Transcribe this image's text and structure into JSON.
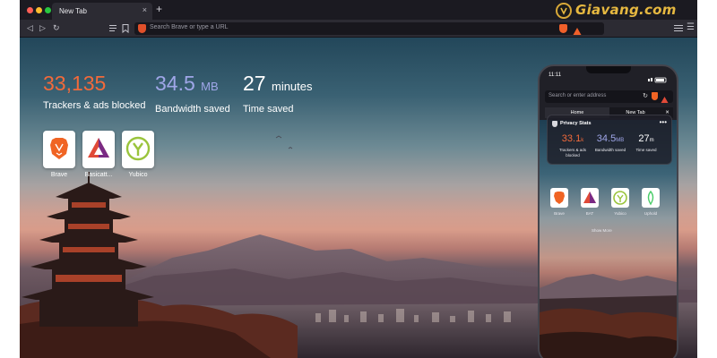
{
  "window": {
    "traffic_lights": [
      "#ff5f57",
      "#febc2e",
      "#28c840"
    ]
  },
  "tab": {
    "title": "New Tab",
    "close_glyph": "×",
    "new_tab_glyph": "+"
  },
  "watermark": {
    "text": "Giavang.com",
    "icon": "coin-logo-icon"
  },
  "toolbar": {
    "back_glyph": "◁",
    "forward_glyph": "▷",
    "reload_glyph": "↻",
    "address_placeholder": "Search Brave or type a URL",
    "reader_icon": "list-icon",
    "bookmark_icon": "bookmark-icon",
    "notification_count": "2",
    "menu_icon": "hamburger-icon"
  },
  "stats": [
    {
      "value": "33,135",
      "unit": "",
      "label": "Trackers & ads blocked",
      "color": "#f26a3b"
    },
    {
      "value": "34.5",
      "unit": "MB",
      "label": "Bandwidth saved",
      "color": "#9fa6e8"
    },
    {
      "value": "27",
      "unit": "minutes",
      "label": "Time saved",
      "color": "#ffffff"
    }
  ],
  "top_sites": [
    {
      "label": "Brave",
      "icon": "brave-lion-icon"
    },
    {
      "label": "Basicatt...",
      "icon": "bat-triangle-icon"
    },
    {
      "label": "Yubico",
      "icon": "yubico-icon"
    }
  ],
  "phone": {
    "time": "11:11",
    "url_placeholder": "Search or enter address",
    "tabs": [
      {
        "label": "Home"
      },
      {
        "label": "New Tab"
      }
    ],
    "tab_close_glyph": "✕",
    "privacy_title": "Privacy Stats",
    "more_glyph": "•••",
    "stats": [
      {
        "value": "33.1",
        "unit": "k",
        "label": "Trackers & ads blocked",
        "color": "#f26a3b"
      },
      {
        "value": "34.5",
        "unit": "MB",
        "label": "Bandwidth saved",
        "color": "#9fa6e8"
      },
      {
        "value": "27",
        "unit": "m",
        "label": "Time saved",
        "color": "#ffffff"
      }
    ],
    "favorites": [
      {
        "label": "Brave",
        "icon": "brave-lion-icon"
      },
      {
        "label": "BAT",
        "icon": "bat-triangle-icon"
      },
      {
        "label": "Yubico",
        "icon": "yubico-icon"
      },
      {
        "label": "Uphold",
        "icon": "uphold-icon"
      }
    ],
    "show_more": "Show More"
  }
}
